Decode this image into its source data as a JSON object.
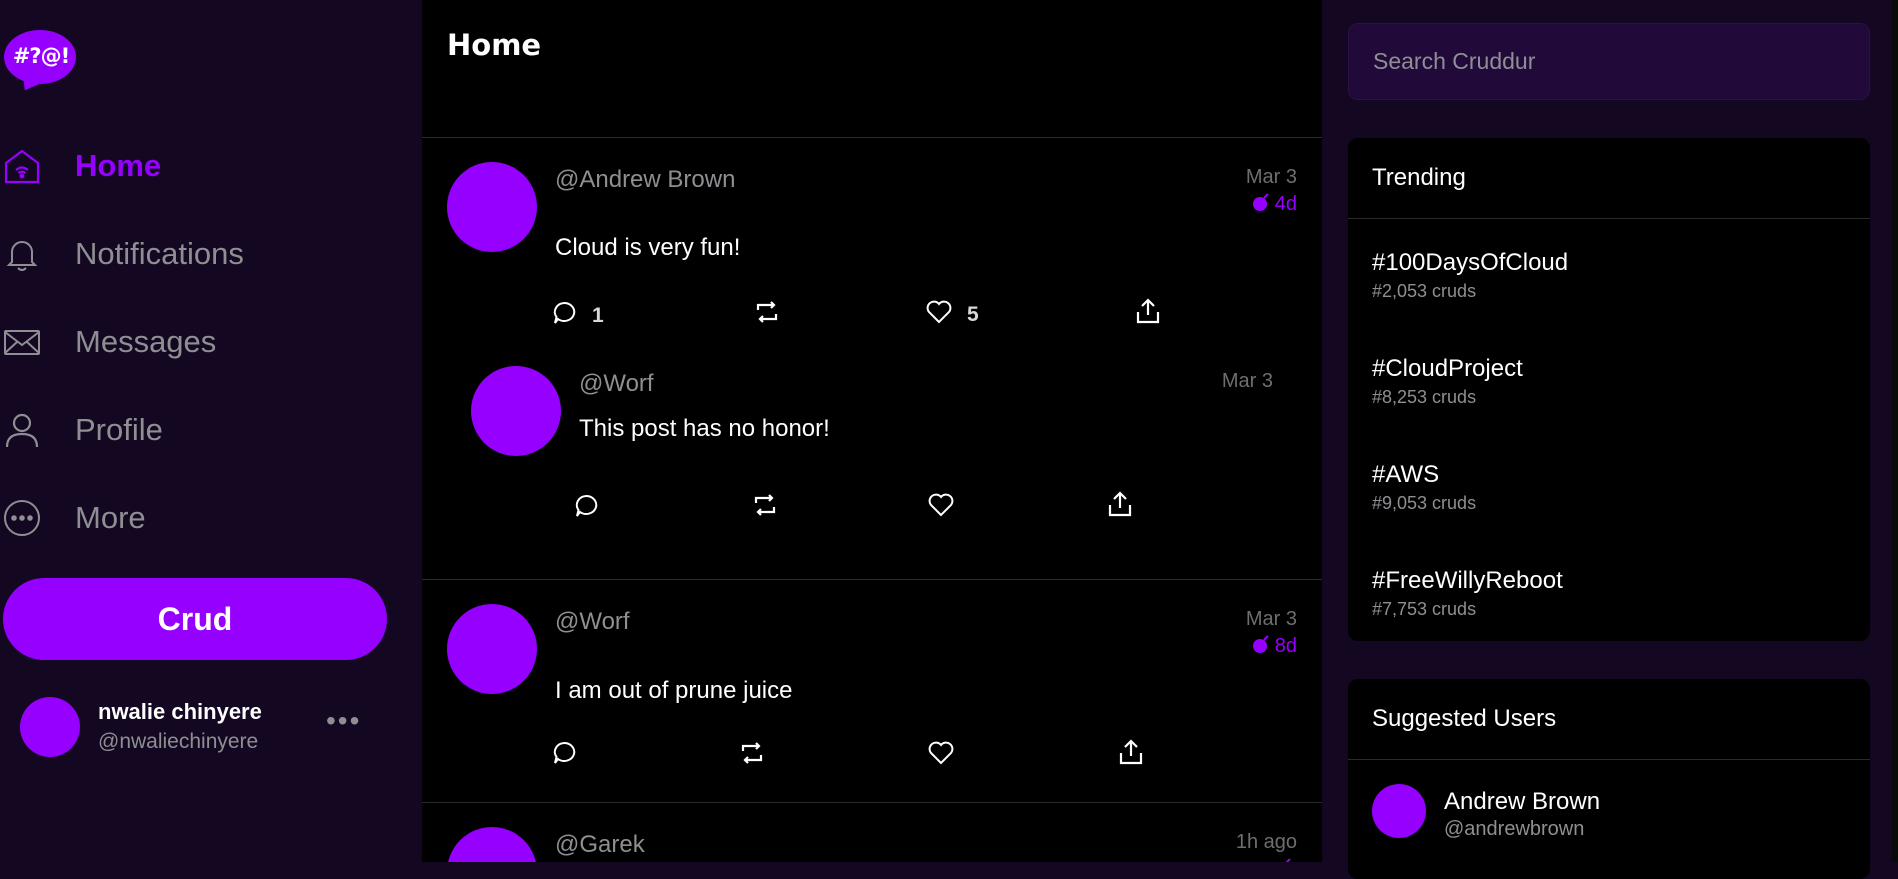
{
  "logo": {
    "text": "#?@!"
  },
  "nav": [
    {
      "label": "Home",
      "icon": "home-icon",
      "active": true
    },
    {
      "label": "Notifications",
      "icon": "bell-icon",
      "active": false
    },
    {
      "label": "Messages",
      "icon": "envelope-icon",
      "active": false
    },
    {
      "label": "Profile",
      "icon": "user-icon",
      "active": false
    },
    {
      "label": "More",
      "icon": "more-circle-icon",
      "active": false
    }
  ],
  "crud_button": "Crud",
  "current_user": {
    "name": "nwalie chinyere",
    "handle": "@nwaliechinyere",
    "menu": "•••"
  },
  "feed": {
    "title": "Home",
    "posts": [
      {
        "handle": "@Andrew Brown",
        "date": "Mar 3",
        "ttl": "4d",
        "text": "Cloud is very fun!",
        "replies": "1",
        "likes": "5",
        "reply": {
          "handle": "@Worf",
          "date": "Mar 3",
          "text": "This post has no honor!"
        }
      },
      {
        "handle": "@Worf",
        "date": "Mar 3",
        "ttl": "8d",
        "text": "I am out of prune juice"
      },
      {
        "handle": "@Garek",
        "date": "1h ago"
      }
    ]
  },
  "search": {
    "placeholder": "Search Cruddur"
  },
  "trending": {
    "title": "Trending",
    "items": [
      {
        "tag": "#100DaysOfCloud",
        "count": "#2,053 cruds"
      },
      {
        "tag": "#CloudProject",
        "count": "#8,253 cruds"
      },
      {
        "tag": "#AWS",
        "count": "#9,053 cruds"
      },
      {
        "tag": "#FreeWillyReboot",
        "count": "#7,753 cruds"
      }
    ]
  },
  "suggested": {
    "title": "Suggested Users",
    "users": [
      {
        "name": "Andrew Brown",
        "handle": "@andrewbrown"
      }
    ]
  },
  "colors": {
    "accent": "#9500ff",
    "sidebar_bg": "#130721",
    "feed_bg": "#000000",
    "muted": "#8f8f93"
  }
}
